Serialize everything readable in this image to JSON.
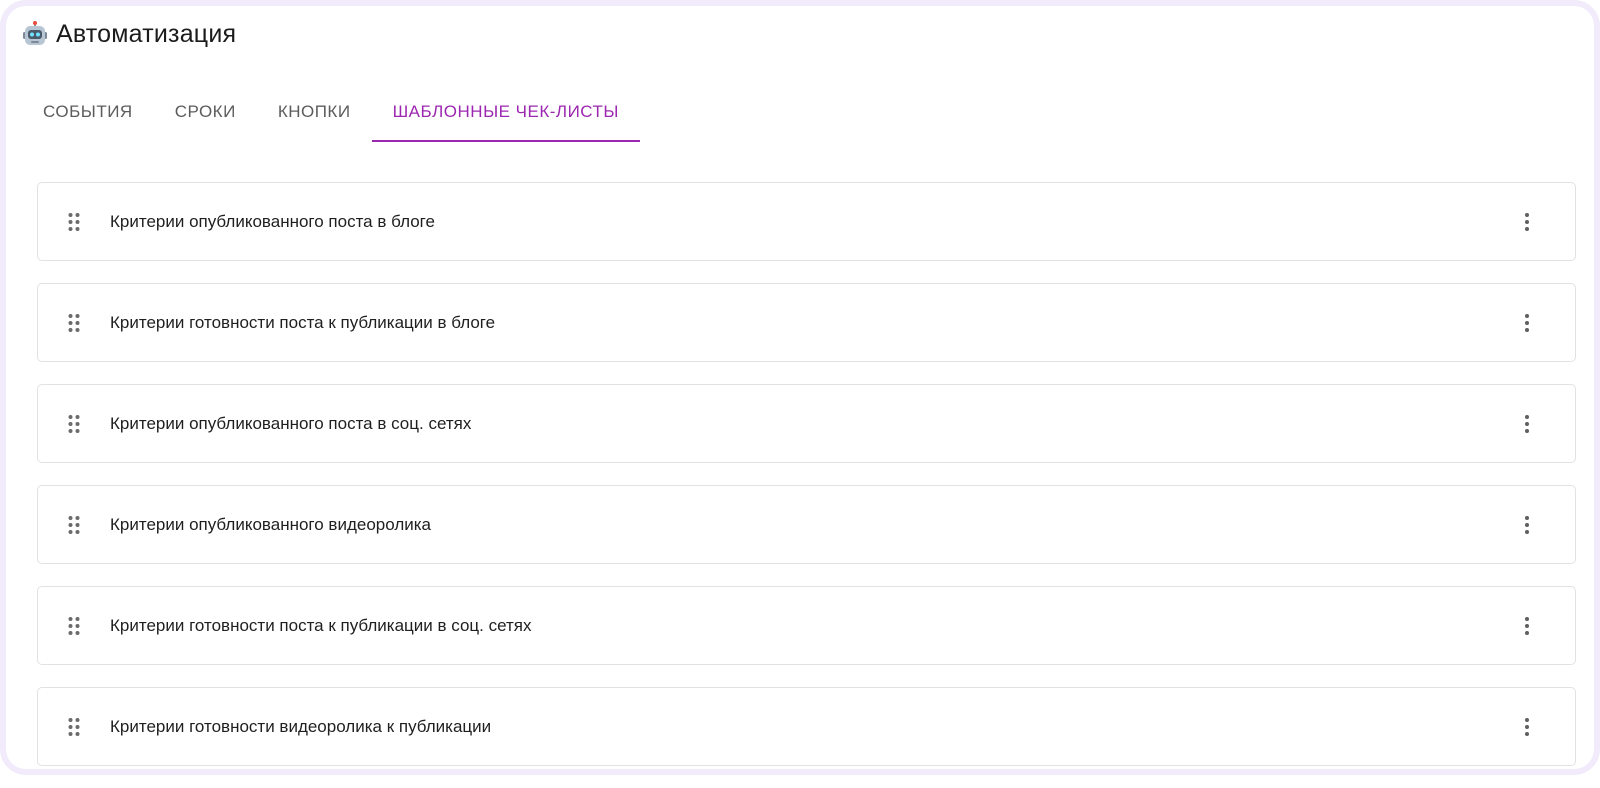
{
  "page": {
    "title": "Автоматизация",
    "title_icon": "robot-icon"
  },
  "tabs": [
    {
      "label": "События",
      "active": false
    },
    {
      "label": "Сроки",
      "active": false
    },
    {
      "label": "Кнопки",
      "active": false
    },
    {
      "label": "Шаблонные чек-листы",
      "active": true
    }
  ],
  "checklists": [
    {
      "label": "Критерии опубликованного поста в блоге"
    },
    {
      "label": "Критерии готовности поста к публикации в блоге"
    },
    {
      "label": "Критерии опубликованного поста в соц. сетях"
    },
    {
      "label": "Критерии опубликованного видеоролика"
    },
    {
      "label": "Критерии готовности поста к публикации в соц. сетях"
    },
    {
      "label": "Критерии готовности видеоролика к публикации"
    }
  ],
  "icons": {
    "drag": "drag-handle-icon",
    "more": "more-vertical-icon"
  },
  "colors": {
    "accent": "#9c27b0",
    "frame_border": "#f1ebfc",
    "tab_inactive": "#5c5c5c",
    "card_border": "#e2e2e2"
  }
}
